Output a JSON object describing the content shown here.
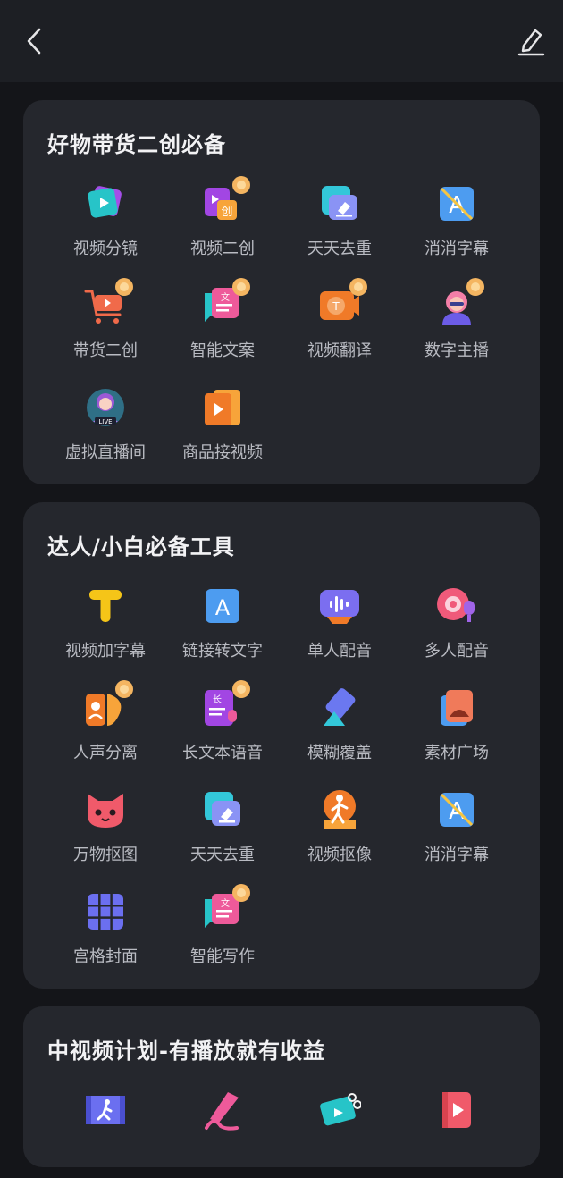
{
  "sections": [
    {
      "title": "好物带货二创必备",
      "tools": [
        {
          "label": "视频分镜",
          "icon": "video-storyboard-icon"
        },
        {
          "label": "视频二创",
          "icon": "video-remix-icon"
        },
        {
          "label": "天天去重",
          "icon": "dedupe-icon"
        },
        {
          "label": "消消字幕",
          "icon": "remove-subtitle-icon"
        },
        {
          "label": "带货二创",
          "icon": "shopping-cart-remix-icon"
        },
        {
          "label": "智能文案",
          "icon": "smart-copywriting-icon"
        },
        {
          "label": "视频翻译",
          "icon": "video-translate-icon"
        },
        {
          "label": "数字主播",
          "icon": "digital-anchor-icon"
        },
        {
          "label": "虚拟直播间",
          "icon": "virtual-live-room-icon"
        },
        {
          "label": "商品接视频",
          "icon": "product-video-icon"
        }
      ]
    },
    {
      "title": "达人/小白必备工具",
      "tools": [
        {
          "label": "视频加字幕",
          "icon": "add-subtitle-icon"
        },
        {
          "label": "链接转文字",
          "icon": "link-to-text-icon"
        },
        {
          "label": "单人配音",
          "icon": "single-voiceover-icon"
        },
        {
          "label": "多人配音",
          "icon": "multi-voiceover-icon"
        },
        {
          "label": "人声分离",
          "icon": "vocal-separation-icon"
        },
        {
          "label": "长文本语音",
          "icon": "long-text-speech-icon"
        },
        {
          "label": "模糊覆盖",
          "icon": "blur-cover-icon"
        },
        {
          "label": "素材广场",
          "icon": "material-square-icon"
        },
        {
          "label": "万物抠图",
          "icon": "cutout-cat-icon"
        },
        {
          "label": "天天去重",
          "icon": "dedupe-icon"
        },
        {
          "label": "视频抠像",
          "icon": "video-matting-icon"
        },
        {
          "label": "消消字幕",
          "icon": "remove-subtitle-icon"
        },
        {
          "label": "宫格封面",
          "icon": "grid-cover-icon"
        },
        {
          "label": "智能写作",
          "icon": "smart-writing-icon"
        }
      ]
    },
    {
      "title": "中视频计划-有播放就有收益",
      "tools": [
        {
          "label": "",
          "icon": "running-video-icon"
        },
        {
          "label": "",
          "icon": "pen-brush-icon"
        },
        {
          "label": "",
          "icon": "ticket-clip-icon"
        },
        {
          "label": "",
          "icon": "play-book-icon"
        }
      ]
    }
  ],
  "colors": {
    "background": "#141519",
    "topbar": "#1d1f24",
    "card": "#25272d",
    "title": "#f2f2f4",
    "label": "#b9bbc2"
  }
}
